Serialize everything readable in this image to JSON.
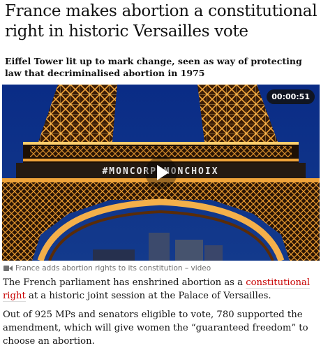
{
  "article": {
    "headline": "France makes abortion a constitutional right in historic Versailles vote",
    "standfirst": "Eiffel Tower lit up to mark change, seen as way of protecting law that decriminalised abortion in 1975",
    "video": {
      "duration": "00:00:51",
      "tower_projection_text": "#MONCORPSMONCHOIX",
      "caption": "France adds abortion rights to its constitution – video",
      "icon": "video-camera-icon"
    },
    "paragraphs": [
      {
        "before": "The French parliament has enshrined abortion as a ",
        "link": "constitutional right",
        "after": " at a historic joint session at the Palace of Versailles."
      },
      {
        "text": "Out of 925 MPs and senators eligible to vote, 780 supported the amendment, which will give women the “guaranteed freedom” to choose an abortion."
      }
    ],
    "colors": {
      "link": "#c70000",
      "text": "#121212",
      "caption": "#707070",
      "sky": "#0c2a6e",
      "tower": "#e8a23a"
    }
  }
}
